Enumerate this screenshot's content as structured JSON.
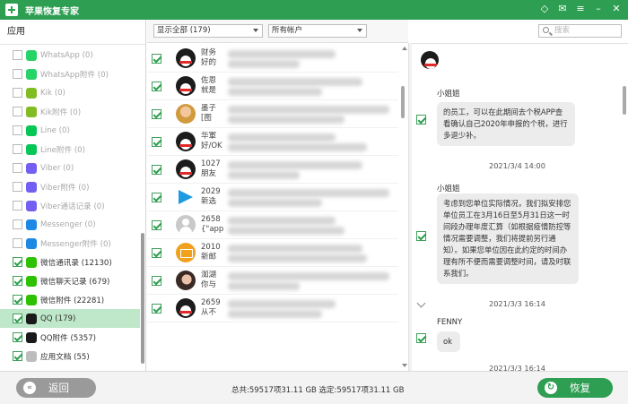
{
  "app": {
    "title": "苹果恢复专家"
  },
  "sidebar": {
    "heading": "应用",
    "items": [
      {
        "label": "WhatsApp (0)",
        "icon": "whatsapp-icon",
        "color": "#25d366",
        "checked": false,
        "dim": true,
        "selected": false
      },
      {
        "label": "WhatsApp附件 (0)",
        "icon": "whatsapp-icon",
        "color": "#25d366",
        "checked": false,
        "dim": true,
        "selected": false
      },
      {
        "label": "Kik (0)",
        "icon": "kik-icon",
        "color": "#82bc23",
        "checked": false,
        "dim": true,
        "selected": false
      },
      {
        "label": "Kik附件 (0)",
        "icon": "kik-icon",
        "color": "#82bc23",
        "checked": false,
        "dim": true,
        "selected": false
      },
      {
        "label": "Line (0)",
        "icon": "line-icon",
        "color": "#06c755",
        "checked": false,
        "dim": true,
        "selected": false
      },
      {
        "label": "Line附件 (0)",
        "icon": "line-icon",
        "color": "#06c755",
        "checked": false,
        "dim": true,
        "selected": false
      },
      {
        "label": "Viber (0)",
        "icon": "viber-icon",
        "color": "#7360f2",
        "checked": false,
        "dim": true,
        "selected": false
      },
      {
        "label": "Viber附件 (0)",
        "icon": "viber-icon",
        "color": "#7360f2",
        "checked": false,
        "dim": true,
        "selected": false
      },
      {
        "label": "Viber通话记录 (0)",
        "icon": "viber-icon",
        "color": "#7360f2",
        "checked": false,
        "dim": true,
        "selected": false
      },
      {
        "label": "Messenger (0)",
        "icon": "messenger-icon",
        "color": "#1e88e5",
        "checked": false,
        "dim": true,
        "selected": false
      },
      {
        "label": "Messenger附件 (0)",
        "icon": "messenger-icon",
        "color": "#1e88e5",
        "checked": false,
        "dim": true,
        "selected": false
      },
      {
        "label": "微信通讯录 (12130)",
        "icon": "wechat-icon",
        "color": "#2dc100",
        "checked": true,
        "dim": false,
        "selected": false
      },
      {
        "label": "微信聊天记录 (679)",
        "icon": "wechat-icon",
        "color": "#2dc100",
        "checked": true,
        "dim": false,
        "selected": false
      },
      {
        "label": "微信附件 (22281)",
        "icon": "wechat-icon",
        "color": "#2dc100",
        "checked": true,
        "dim": false,
        "selected": false
      },
      {
        "label": "QQ (179)",
        "icon": "qq-icon",
        "color": "#1a1a1a",
        "checked": true,
        "dim": false,
        "selected": true
      },
      {
        "label": "QQ附件 (5357)",
        "icon": "qq-icon",
        "color": "#1a1a1a",
        "checked": true,
        "dim": false,
        "selected": false
      },
      {
        "label": "应用文档 (55)",
        "icon": "document-icon",
        "color": "#bdbdbd",
        "checked": true,
        "dim": false,
        "selected": false
      }
    ]
  },
  "filters": {
    "show": "显示全部 (179)",
    "account": "所有帐户",
    "search_placeholder": "搜索"
  },
  "conversations": [
    {
      "avatar": "qq-penguin",
      "line1": "财务",
      "line2": "好的"
    },
    {
      "avatar": "qq-penguin",
      "line1": "佐恩",
      "line2": "就是"
    },
    {
      "avatar": "photo",
      "line1": "墨子",
      "line2": "[图"
    },
    {
      "avatar": "qq-penguin",
      "line1": "华軍",
      "line2": "好/OK"
    },
    {
      "avatar": "qq-penguin",
      "line1": "1027",
      "line2": "朋友"
    },
    {
      "avatar": "video",
      "line1": "2029",
      "line2": "新选"
    },
    {
      "avatar": "default",
      "line1": "2658",
      "line2": "{\"app"
    },
    {
      "avatar": "mail",
      "line1": "2010",
      "line2": "新邮"
    },
    {
      "avatar": "photo2",
      "line1": "洳湖",
      "line2": "你与"
    },
    {
      "avatar": "qq-penguin",
      "line1": "2659",
      "line2": "从不"
    }
  ],
  "chat": {
    "messages": [
      {
        "sender": "小姐姐",
        "text": "的员工，可以在此期间去个税APP查看确认自己2020年申报的个税，进行多退少补。",
        "time": "2021/3/4 14:00"
      },
      {
        "sender": "小姐姐",
        "text": "考虑到您单位实际情况，我们拟安排您单位员工在3月16日至5月31日这一时间段办理年度汇算（如根据疫情防控等情况需要调整，我们将提前另行通知）。如果您单位因在此约定的时间办理有所不便而需要调整时间，请及时联系我们。",
        "time": "2021/3/3 16:14"
      },
      {
        "sender": "FENNY",
        "text": "ok",
        "time": "2021/3/3 16:14"
      }
    ]
  },
  "footer": {
    "back": "返回",
    "totals": "总共:59517项31.11 GB 选定:59517项31.11 GB",
    "restore": "恢复"
  },
  "colors": {
    "brand": "#2e9e52",
    "selected_row": "#bfe7c9"
  }
}
